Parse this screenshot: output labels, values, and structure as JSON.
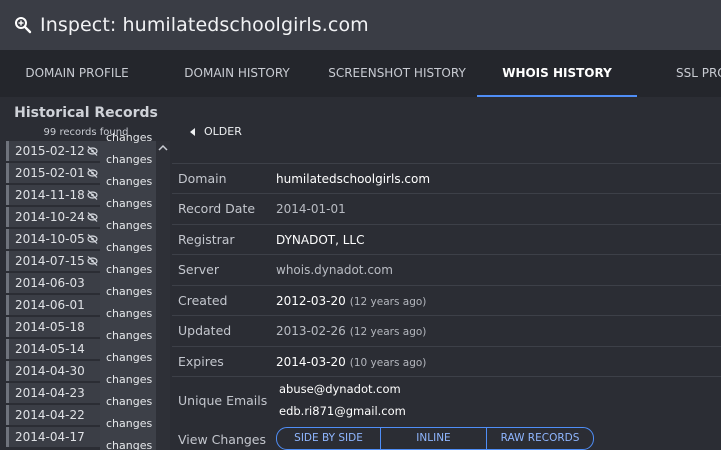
{
  "header": {
    "title": "Inspect: humilatedschoolgirls.com",
    "icon": "search-icon"
  },
  "tabs": [
    {
      "label": "DOMAIN PROFILE",
      "active": false
    },
    {
      "label": "DOMAIN HISTORY",
      "active": false
    },
    {
      "label": "SCREENSHOT HISTORY",
      "active": false
    },
    {
      "label": "WHOIS HISTORY",
      "active": true
    },
    {
      "label": "SSL PRO",
      "active": false
    }
  ],
  "sidebar": {
    "title": "Historical Records",
    "count": "99 records found",
    "records": [
      {
        "date": "2015-02-12",
        "hidden_icon": true,
        "changes": "changes"
      },
      {
        "date": "2015-02-01",
        "hidden_icon": true,
        "changes": "changes"
      },
      {
        "date": "2014-11-18",
        "hidden_icon": true,
        "changes": "changes"
      },
      {
        "date": "2014-10-24",
        "hidden_icon": true,
        "changes": "changes"
      },
      {
        "date": "2014-10-05",
        "hidden_icon": true,
        "changes": "changes"
      },
      {
        "date": "2014-07-15",
        "hidden_icon": true,
        "changes": "changes"
      },
      {
        "date": "2014-06-03",
        "hidden_icon": false,
        "changes": "changes"
      },
      {
        "date": "2014-06-01",
        "hidden_icon": false,
        "changes": "changes"
      },
      {
        "date": "2014-05-18",
        "hidden_icon": false,
        "changes": "changes"
      },
      {
        "date": "2014-05-14",
        "hidden_icon": false,
        "changes": "changes"
      },
      {
        "date": "2014-04-30",
        "hidden_icon": false,
        "changes": "changes"
      },
      {
        "date": "2014-04-23",
        "hidden_icon": false,
        "changes": "changes"
      },
      {
        "date": "2014-04-22",
        "hidden_icon": false,
        "changes": "changes"
      },
      {
        "date": "2014-04-17",
        "hidden_icon": false,
        "changes": "changes"
      }
    ]
  },
  "main": {
    "older_label": "OLDER",
    "fields": {
      "domain": {
        "label": "Domain",
        "value": "humilatedschoolgirls.com"
      },
      "record_date": {
        "label": "Record Date",
        "value": "2014-01-01"
      },
      "registrar": {
        "label": "Registrar",
        "value": "DYNADOT, LLC"
      },
      "server": {
        "label": "Server",
        "value": "whois.dynadot.com"
      },
      "created": {
        "label": "Created",
        "value": "2012-03-20",
        "ago": "(12 years ago)"
      },
      "updated": {
        "label": "Updated",
        "value": "2013-02-26",
        "ago": "(12 years ago)"
      },
      "expires": {
        "label": "Expires",
        "value": "2014-03-20",
        "ago": "(10 years ago)"
      },
      "emails": {
        "label": "Unique Emails",
        "values": [
          "abuse@dynadot.com",
          "edb.ri871@gmail.com"
        ]
      },
      "view_changes": {
        "label": "View Changes",
        "buttons": [
          "SIDE BY SIDE",
          "INLINE",
          "RAW RECORDS"
        ]
      }
    }
  },
  "colors": {
    "accent": "#4f8ef7",
    "background": "#2b2d34",
    "header": "#3a3d45"
  }
}
